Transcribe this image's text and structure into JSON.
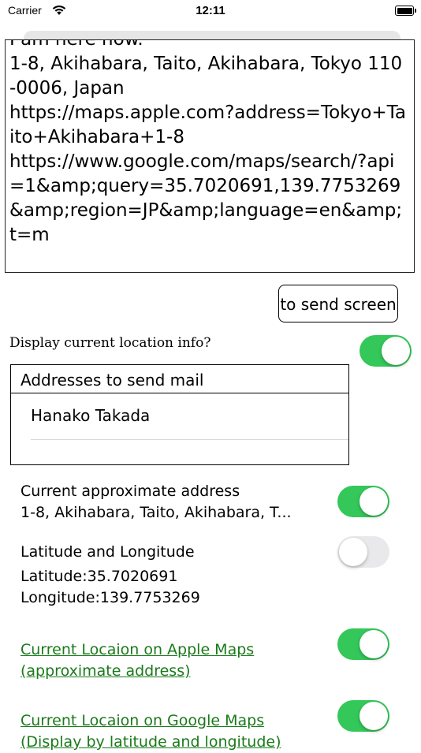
{
  "status_bar": {
    "carrier": "Carrier",
    "time": "12:11"
  },
  "message": {
    "text": "I am here now.\n1-8, Akihabara, Taito, Akihabara, Tokyo 110-0006, Japan\nhttps://maps.apple.com?address=Tokyo+Taito+Akihabara+1-8\nhttps://www.google.com/maps/search/?api=1&amp;query=35.7020691,139.7753269&amp;region=JP&amp;language=en&amp;t=m"
  },
  "send_button": {
    "label": "to send screen"
  },
  "display_option": {
    "label": "Display current location info?",
    "enabled": true
  },
  "addresses": {
    "header": "Addresses to send mail",
    "items": [
      "Hanako Takada"
    ]
  },
  "options": {
    "approx_address": {
      "title": "Current approximate address",
      "value": "1-8, Akihabara, Taito, Akihabara, T...",
      "enabled": true
    },
    "lat_long": {
      "title": "Latitude and Longitude",
      "latitude": "Latitude:35.7020691",
      "longitude": "Longitude:139.7753269",
      "enabled": false
    },
    "apple_maps": {
      "line1": "Current Locaion on Apple Maps",
      "line2": "(approximate address)",
      "enabled": true
    },
    "google_maps": {
      "line1": "Current Locaion on Google Maps",
      "line2": "(Display by latitude and longitude)",
      "enabled": true
    }
  },
  "colors": {
    "toggle_on": "#34c759",
    "toggle_off": "#e9e9eb",
    "link": "#1a7a1a"
  }
}
